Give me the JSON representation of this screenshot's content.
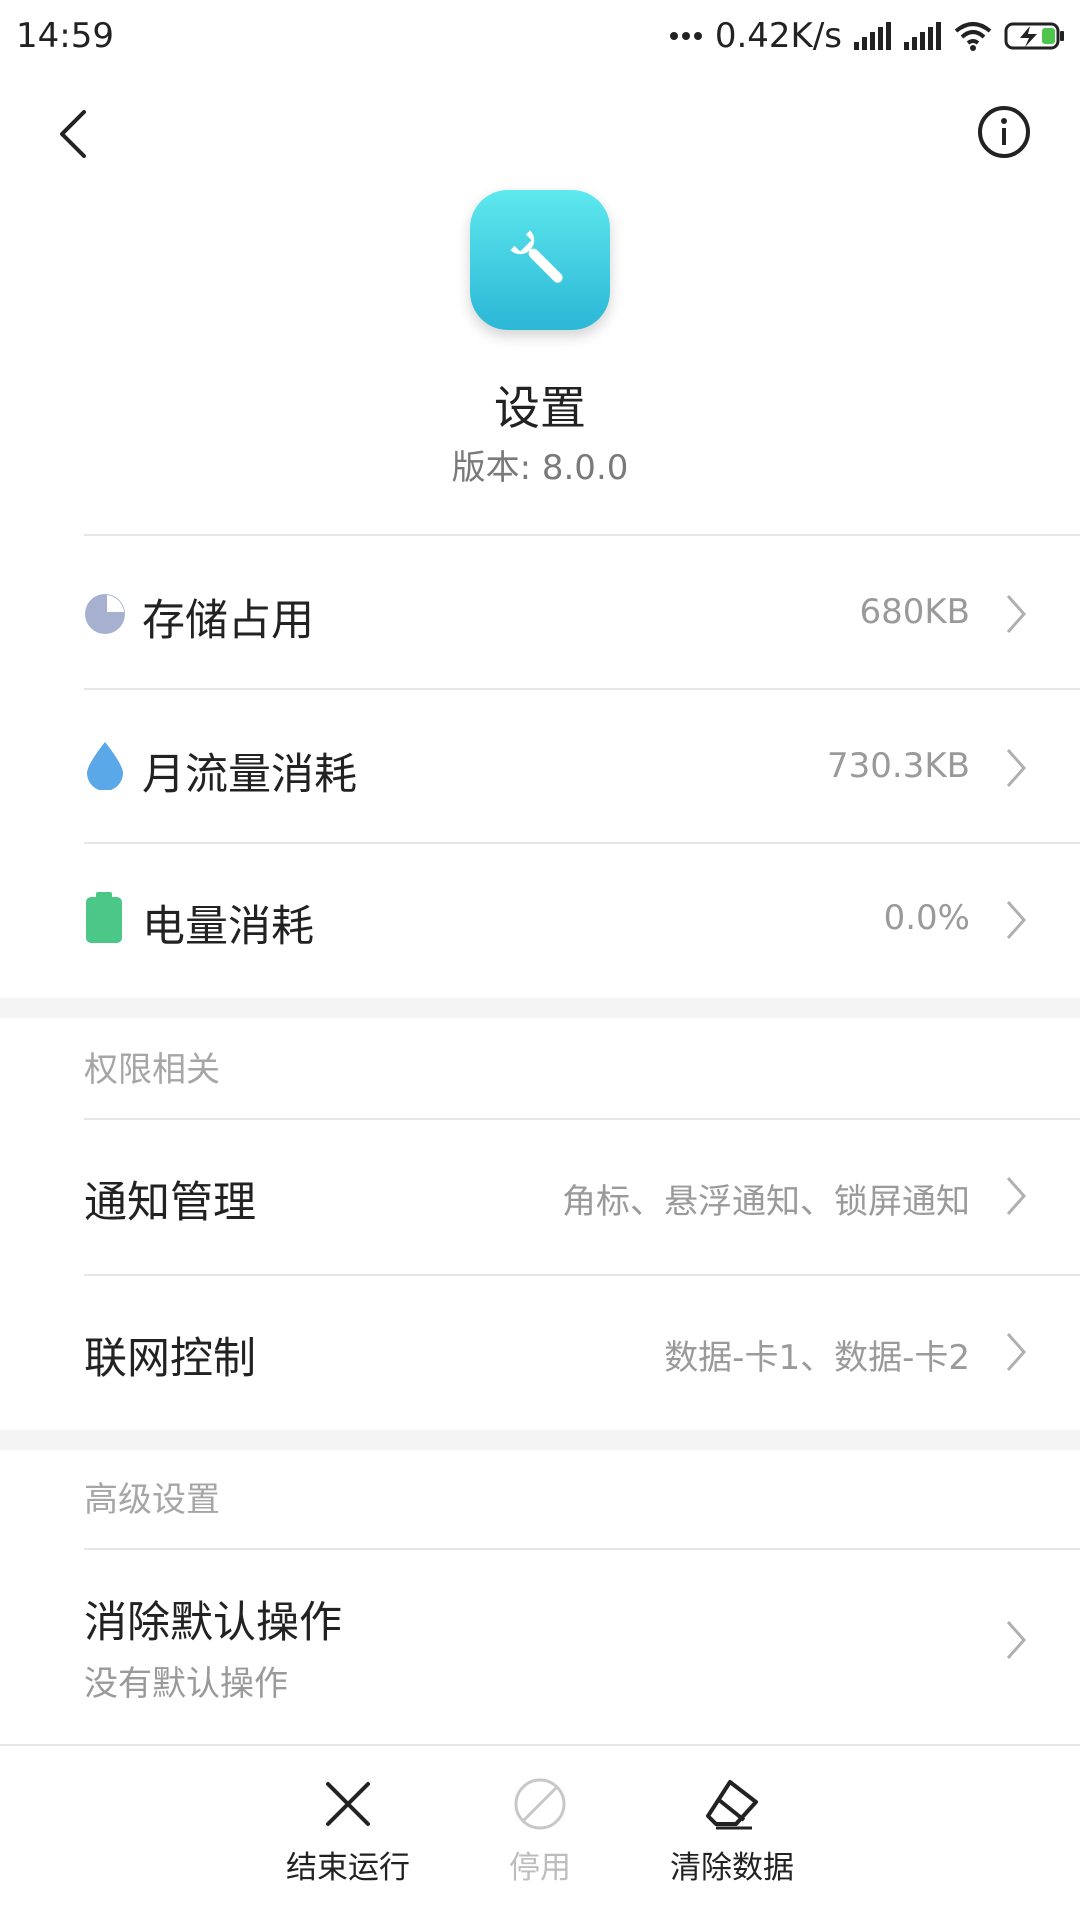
{
  "status_bar": {
    "time": "14:59",
    "more_dots_icon": "more-dots-icon",
    "network_speed": "0.42K/s",
    "icons": [
      "signal-icon",
      "signal-icon",
      "wifi-icon",
      "battery-charging-icon"
    ]
  },
  "header": {
    "back_icon": "back-arrow-icon",
    "info_icon": "info-icon"
  },
  "app": {
    "icon": "wrench-icon",
    "name": "设置",
    "version": "版本: 8.0.0"
  },
  "usage_items": [
    {
      "icon": "pie-chart-icon",
      "title": "存储占用",
      "value": "680KB",
      "color": "#a6b0cf"
    },
    {
      "icon": "water-drop-icon",
      "title": "月流量消耗",
      "value": "730.3KB",
      "color": "#5aa8e8"
    },
    {
      "icon": "battery-icon",
      "title": "电量消耗",
      "value": "0.0%",
      "color": "#4cc788"
    }
  ],
  "permissions": {
    "section_label": "权限相关",
    "items": [
      {
        "title": "通知管理",
        "value": "角标、悬浮通知、锁屏通知"
      },
      {
        "title": "联网控制",
        "value": "数据-卡1、数据-卡2"
      }
    ]
  },
  "advanced": {
    "section_label": "高级设置",
    "items": [
      {
        "title": "消除默认操作",
        "subtitle": "没有默认操作"
      }
    ]
  },
  "bottom_actions": [
    {
      "icon": "close-x-icon",
      "label": "结束运行",
      "enabled": true
    },
    {
      "icon": "disabled-circle-icon",
      "label": "停用",
      "enabled": false
    },
    {
      "icon": "eraser-icon",
      "label": "清除数据",
      "enabled": true
    }
  ],
  "colors": {
    "icon_gradient_top": "#5ee8ee",
    "icon_gradient_bottom": "#2bb7d6",
    "secondary_text": "#9a9a9a",
    "disabled": "#bdbdbd"
  }
}
